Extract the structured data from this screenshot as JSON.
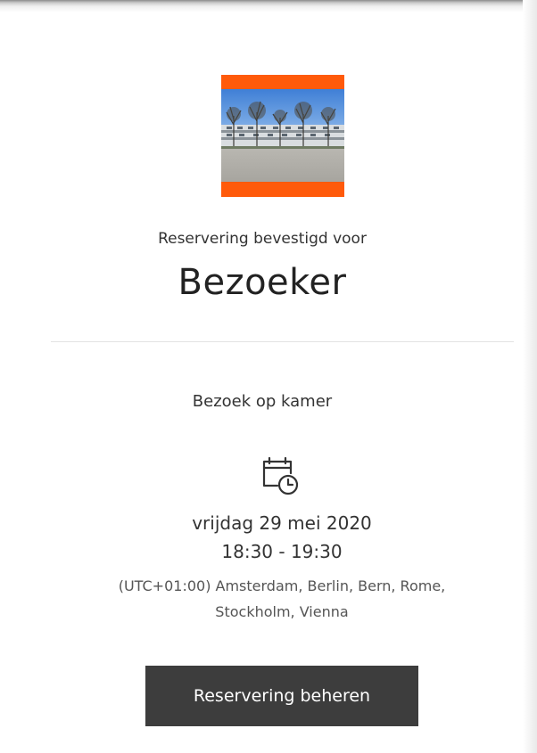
{
  "brand": {
    "accent_color": "#ff5a0a",
    "logo_icon": "building-photo-logo"
  },
  "confirmation": {
    "heading": "Reservering bevestigd voor",
    "name": "Bezoeker"
  },
  "booking": {
    "service": "Bezoek op kamer",
    "icon": "calendar-clock-icon",
    "date": "vrijdag 29 mei 2020",
    "time": "18:30 - 19:30",
    "timezone": "(UTC+01:00) Amsterdam, Berlin, Bern, Rome, Stockholm, Vienna"
  },
  "actions": {
    "manage_label": "Reservering beheren",
    "button_color": "#3d3d3d"
  }
}
